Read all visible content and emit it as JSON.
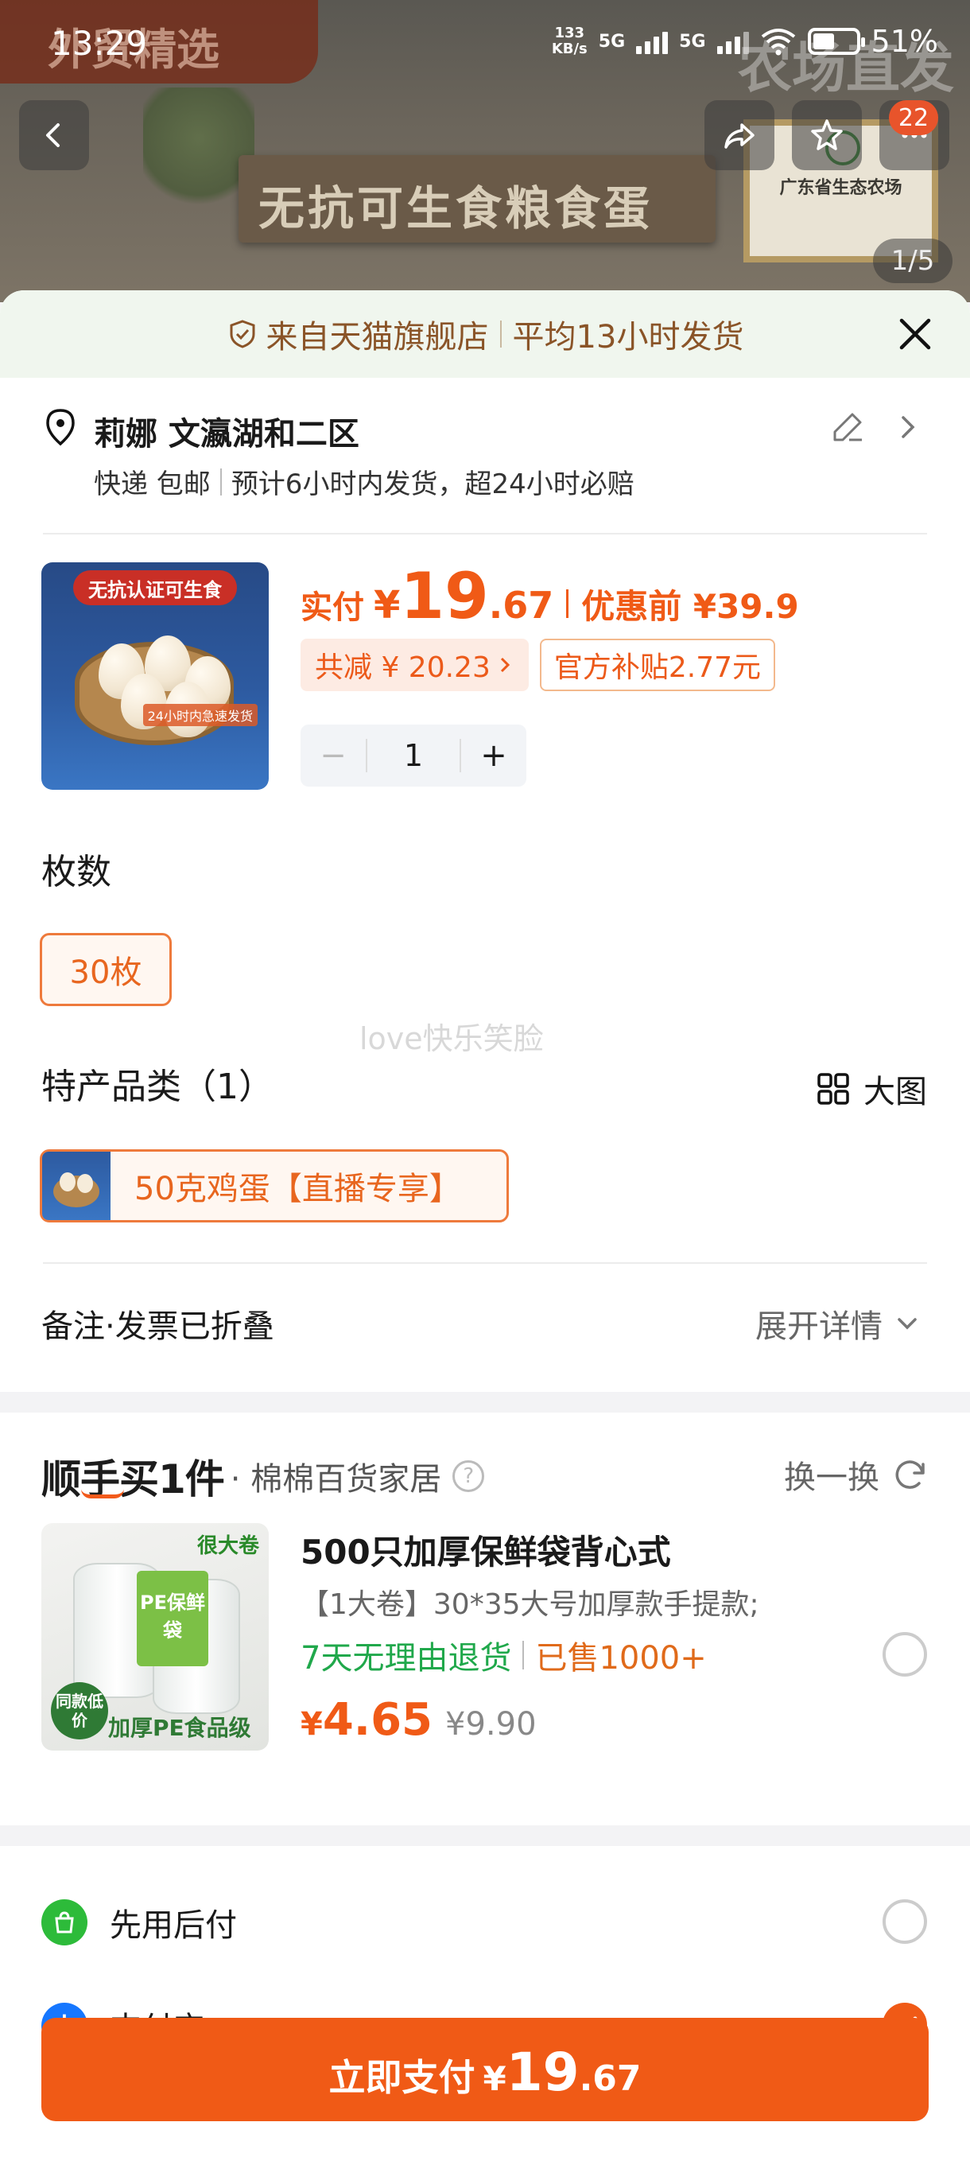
{
  "status_bar": {
    "time": "13:29",
    "net_speed_value": "133",
    "net_speed_unit": "KB/s",
    "signal_1": "5G",
    "signal_2": "5G",
    "battery": "51%"
  },
  "hero": {
    "corner_tag": "外贸精选",
    "sign_text": "无抗可生食粮食蛋",
    "overlay_text": "农场直发",
    "certificate_title": "广东省生态农场",
    "badge_count": "22",
    "page_indicator": "1/5"
  },
  "banner": {
    "store": "来自天猫旗舰店",
    "shipping": "平均13小时发货"
  },
  "address": {
    "name": "莉娜 文瀛湖和二区",
    "delivery": "快递 包邮",
    "promise": "预计6小时内发货，超24小时必赔"
  },
  "product": {
    "thumb_label": "无抗认证可生食",
    "thumb_promo": "24小时内急速发货",
    "price_label": "实付",
    "currency": "¥",
    "price_int": "19",
    "price_dec": ".67",
    "original_label": "优惠前 ¥39.9",
    "discount_tag": "共减 ¥ 20.23",
    "subsidy_tag": "官方补贴2.77元",
    "quantity": "1",
    "minus": "−",
    "plus": "+"
  },
  "spec": {
    "count_title": "枚数",
    "count_option": "30枚",
    "watermark": "love快乐笑脸",
    "category_title": "特产品类（1）",
    "big_view": "大图",
    "category_option": "50克鸡蛋【直播专享】"
  },
  "notes": {
    "label": "备注·发票已折叠",
    "expand": "展开详情"
  },
  "addon": {
    "logo": "顺手买1件",
    "shop": "· 棉棉百货家居",
    "help": "?",
    "swap": "换一换",
    "img_big": "很大卷",
    "img_label": "PE保鲜袋",
    "img_badge": "同款低价",
    "img_grade": "加厚PE食品级",
    "title": "500只加厚保鲜袋背心式",
    "desc": "【1大卷】30*35大号加厚款手提款;",
    "return_policy": "7天无理由退货",
    "sold": "已售1000+",
    "price_currency": "¥",
    "price": "4.65",
    "was_price": "¥9.90"
  },
  "payment": {
    "option_1": "先用后付",
    "option_2": "支付宝",
    "alipay_glyph": "支",
    "selected": "支付宝"
  },
  "pay_button": {
    "label": "立即支付",
    "currency": "¥",
    "int": "19",
    "dec": ".67"
  },
  "colors": {
    "accent": "#f05a16",
    "banner_bg": "#f0f6ee",
    "green": "#20a84b",
    "alipay_blue": "#1677ff",
    "paylater_green": "#2dbb3a"
  },
  "icons": [
    "back-icon",
    "share-icon",
    "star-icon",
    "more-icon",
    "shield-icon",
    "close-icon",
    "location-pin-icon",
    "edit-icon",
    "chevron-right-icon",
    "grid-icon",
    "chevron-down-icon",
    "refresh-icon",
    "help-icon",
    "paylater-icon",
    "alipay-icon",
    "check-icon"
  ]
}
